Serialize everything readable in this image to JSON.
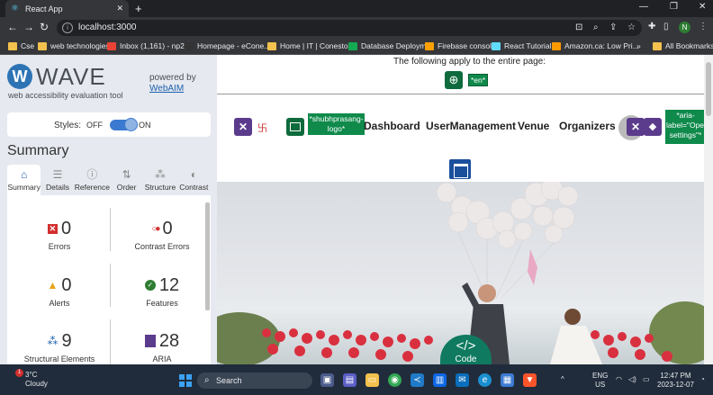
{
  "browser": {
    "tab_title": "React App",
    "url": "localhost:3000",
    "profile_initial": "N",
    "bookmarks": [
      {
        "label": "Cse",
        "color": "#f2c14e"
      },
      {
        "label": "web technologies",
        "color": "#f2c14e"
      },
      {
        "label": "Inbox (1,161) - np2...",
        "color": "#ea4335"
      },
      {
        "label": "Homepage - eCone...",
        "color": "#333333"
      },
      {
        "label": "Home | IT | Conesto...",
        "color": "#f2c14e"
      },
      {
        "label": "Database Deploym...",
        "color": "#13aa52"
      },
      {
        "label": "Firebase console",
        "color": "#ffa000"
      },
      {
        "label": "React Tutorial",
        "color": "#61dafb"
      },
      {
        "label": "Amazon.ca: Low Pri...",
        "color": "#ff9900"
      }
    ],
    "more_bookmarks": "»",
    "all_bookmarks": "All Bookmarks"
  },
  "wave": {
    "title": "WAVE",
    "subtitle": "web accessibility evaluation tool",
    "powered_by": "powered by",
    "webaim": "WebAIM",
    "styles_label": "Styles:",
    "styles_off": "OFF",
    "styles_on": "ON",
    "summary_title": "Summary",
    "tabs": [
      "Summary",
      "Details",
      "Reference",
      "Order",
      "Structure",
      "Contrast"
    ],
    "stats": {
      "errors": {
        "value": "0",
        "label": "Errors"
      },
      "contrast": {
        "value": "0",
        "label": "Contrast Errors"
      },
      "alerts": {
        "value": "0",
        "label": "Alerts"
      },
      "features": {
        "value": "12",
        "label": "Features"
      },
      "structural": {
        "value": "9",
        "label": "Structural Elements"
      },
      "aria": {
        "value": "28",
        "label": "ARIA"
      }
    }
  },
  "page": {
    "applies_text": "The following apply to the entire page:",
    "lang_tag": "*en*",
    "logo_alt": "*shubhprasang-logo*",
    "nav": [
      "Dashboard",
      "UserManagement",
      "Venue",
      "Organizers"
    ],
    "aria_tag": "*aria-label=\"Open settings\"*",
    "code_label": "Code",
    "code_symbol": "</>"
  },
  "taskbar": {
    "temp": "3°C",
    "weather": "Cloudy",
    "notification_count": "1",
    "search": "Search",
    "lang1": "ENG",
    "lang2": "US",
    "time": "12:47 PM",
    "date": "2023-12-07"
  }
}
